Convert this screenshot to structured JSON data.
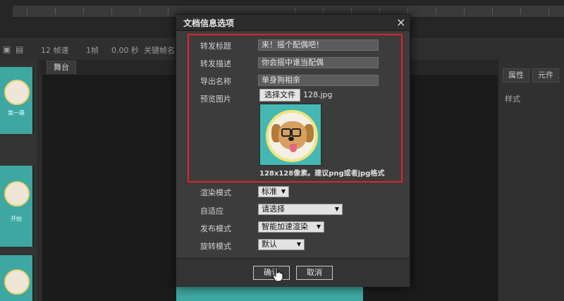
{
  "toolbar": {
    "fps": "12 帧速",
    "frame": "1帧",
    "time": "0.00 秒",
    "keyframe": "关键帧名"
  },
  "left_thumbs": [
    {
      "caption": "第一幕"
    },
    {
      "caption": "开始"
    }
  ],
  "stage": {
    "tab_label": "舞台"
  },
  "right_panel": {
    "tabs": [
      "属性",
      "元件"
    ],
    "section": "样式"
  },
  "dialog": {
    "title": "文档信息选项",
    "close_glyph": "×",
    "fields": [
      {
        "label": "转发标题",
        "value": "来！摇个配偶吧！"
      },
      {
        "label": "转发描述",
        "value": "你会摇中谁当配偶"
      },
      {
        "label": "导出名称",
        "value": "单身狗相亲"
      }
    ],
    "preview": {
      "label": "预览图片",
      "file_button": "选择文件",
      "file_name": "128.jpg",
      "hint": "128x128像素。建议png或者jpg格式"
    },
    "render_mode": {
      "label": "渲染模式",
      "value": "标准"
    },
    "adaptive": {
      "label": "自适应",
      "value": "请选择"
    },
    "publish_mode": {
      "label": "发布模式",
      "value": "智能加速渲染"
    },
    "rotate_mode": {
      "label": "旋转模式",
      "value": "默认"
    },
    "confirm": "确认",
    "cancel": "取消"
  },
  "colors": {
    "highlight_border": "#e0232a",
    "stage_teal": "#3fa7a1"
  }
}
